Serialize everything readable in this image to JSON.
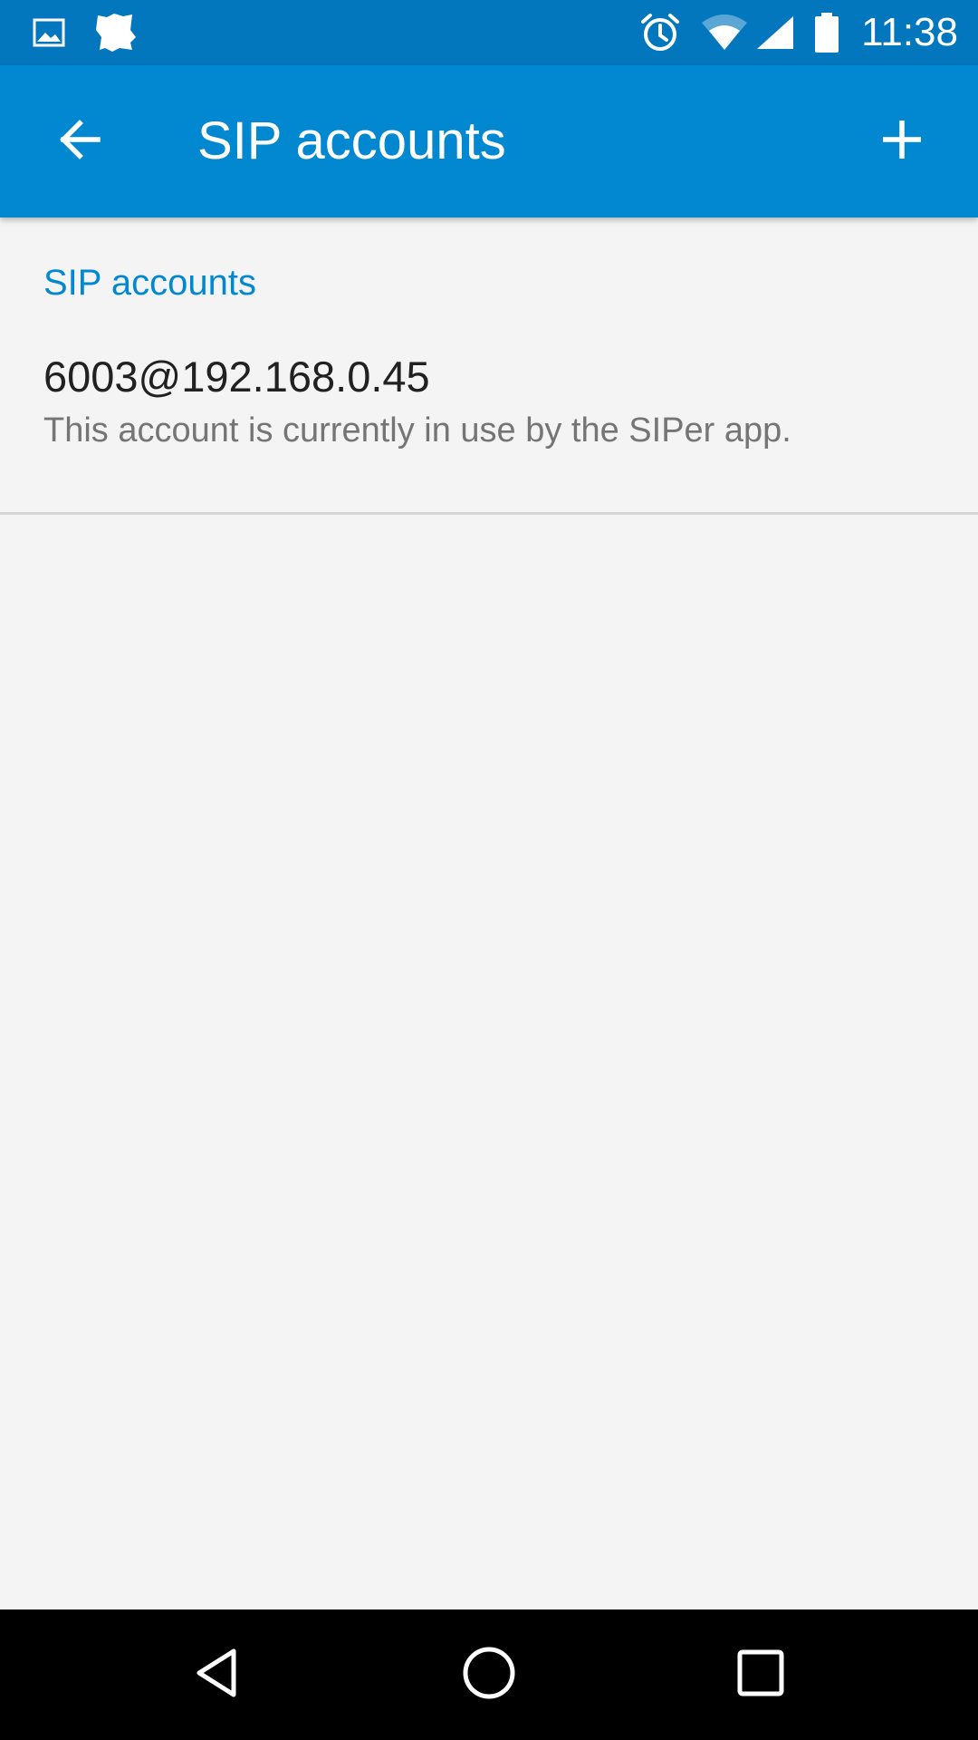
{
  "status_bar": {
    "time": "11:38",
    "left_icons": [
      "image-icon",
      "notification-app-icon"
    ],
    "right_icons": [
      "alarm-icon",
      "wifi-icon",
      "cellular-signal-icon",
      "battery-icon"
    ]
  },
  "app_bar": {
    "title": "SIP accounts",
    "back_icon": "arrow-back-icon",
    "add_icon": "add-icon"
  },
  "preferences": {
    "section_header": "SIP accounts",
    "accounts": [
      {
        "title": "6003@192.168.0.45",
        "summary": "This account is currently in use by the SIPer app."
      }
    ]
  },
  "nav_bar": {
    "buttons": [
      "back-triangle-icon",
      "home-circle-icon",
      "recents-square-icon"
    ]
  },
  "colors": {
    "status_bar": "#0277bd",
    "app_bar": "#0288d1",
    "accent": "#0288d1",
    "background": "#f4f4f4",
    "nav_bar": "#000000"
  }
}
